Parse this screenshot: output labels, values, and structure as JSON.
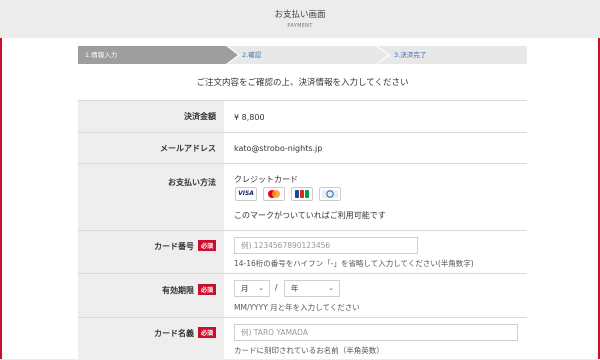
{
  "header": {
    "title": "お支払い画面",
    "subtitle": "PAYMENT"
  },
  "steps": [
    {
      "label": "1.情報入力"
    },
    {
      "label": "2.確認"
    },
    {
      "label": "3.決済完了"
    }
  ],
  "instruction": "ご注文内容をご確認の上、決済情報を入力してください",
  "rows": {
    "amount": {
      "label": "決済金額",
      "value": "¥ 8,800"
    },
    "email": {
      "label": "メールアドレス",
      "value": "kato@strobo-nights.jp"
    },
    "method": {
      "label": "お支払い方法",
      "value": "クレジットカード",
      "cards": [
        "VISA",
        "MasterCard",
        "JCB",
        "Diners"
      ],
      "note": "このマークがついていればご利用可能です"
    },
    "card_number": {
      "label": "カード番号",
      "required": "必須",
      "placeholder": "例) 1234567890123456",
      "hint": "14-16桁の番号をハイフン「-」を省略して入力してください(半角数字)"
    },
    "expiry": {
      "label": "有効期限",
      "required": "必須",
      "month": "月",
      "slash": "/",
      "year": "年",
      "hint": "MM/YYYY 月と年を入力してください"
    },
    "card_name": {
      "label": "カード名義",
      "required": "必須",
      "placeholder": "例) TARO YAMADA",
      "hint": "カードに刻印されているお名前（半角英数）"
    }
  },
  "colors": {
    "accent": "#c8102e",
    "step_active": "#9e9e9e",
    "link": "#3a6fb0"
  }
}
